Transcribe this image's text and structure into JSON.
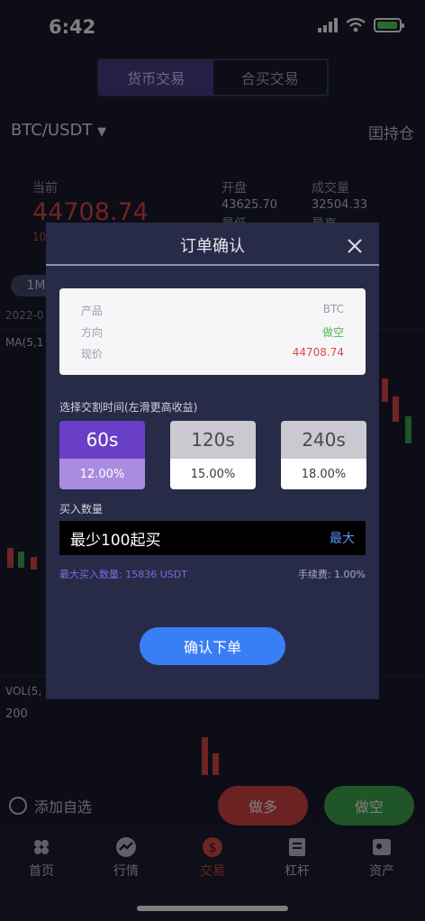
{
  "status_bar": {
    "time": "6:42"
  },
  "header": {
    "tabs": [
      {
        "label": "货币交易",
        "active": true
      },
      {
        "label": "合买交易",
        "active": false
      }
    ],
    "pair": "BTC/USDT",
    "positions_label": "囯持仓"
  },
  "ticker": {
    "current_label": "当前",
    "current_price": "44708.74",
    "change_partial": "10",
    "open_label": "开盘",
    "open_value": "43625.70",
    "low_label": "最低",
    "volume_label": "成交量",
    "volume_value": "32504.33",
    "high_label": "最高"
  },
  "chart": {
    "range_label": "1M",
    "date_partial": "2022-0",
    "ma_label": "MA(5,1",
    "vol_label": "VOL(5,",
    "vol_value": "200"
  },
  "actions": {
    "add_favorite": "添加自选",
    "long": "做多",
    "short": "做空"
  },
  "tabbar": {
    "items": [
      {
        "label": "首页",
        "icon": "home-icon",
        "active": false
      },
      {
        "label": "行情",
        "icon": "market-icon",
        "active": false
      },
      {
        "label": "交易",
        "icon": "trade-icon",
        "active": true
      },
      {
        "label": "杠杆",
        "icon": "leverage-icon",
        "active": false
      },
      {
        "label": "资产",
        "icon": "assets-icon",
        "active": false
      }
    ]
  },
  "modal": {
    "title": "订单确认",
    "info": {
      "product_label": "产品",
      "product_value": "BTC",
      "direction_label": "方向",
      "direction_value": "做空",
      "price_label": "现价",
      "price_value": "44708.74"
    },
    "time_label": "选择交割时间(左滑更高收益)",
    "options": [
      {
        "time": "60s",
        "rate": "12.00%",
        "selected": true
      },
      {
        "time": "120s",
        "rate": "15.00%",
        "selected": false
      },
      {
        "time": "240s",
        "rate": "18.00%",
        "selected": false
      }
    ],
    "amount_label": "买入数量",
    "amount_placeholder": "最少100起买",
    "max_label": "最大",
    "max_buy": "最大买入数量: 15836 USDT",
    "fee": "手续费: 1.00%",
    "confirm": "确认下单"
  },
  "colors": {
    "accent": "#6a3fc8",
    "up_red": "#e04848",
    "down_green": "#3faa4f",
    "confirm_blue": "#3a7ef5"
  }
}
